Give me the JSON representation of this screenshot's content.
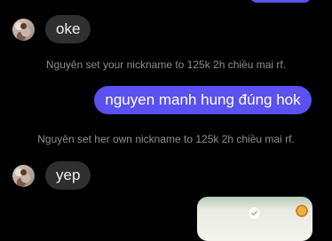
{
  "messages": {
    "incoming_1": {
      "text": "oke"
    },
    "system_1": {
      "text": "Nguyên set your nickname to 125k 2h chiều mai rf."
    },
    "outgoing_1": {
      "text": "nguyen manh hung đúng hok"
    },
    "system_2": {
      "text": "Nguyên set her own nickname to 125k 2h chiều mai rf."
    },
    "incoming_2": {
      "text": "yep"
    }
  },
  "colors": {
    "background": "#000000",
    "outgoing_bubble": "#5b50f0",
    "incoming_bubble": "#2f2f2f",
    "system_text": "#8e8e93"
  },
  "icons": {
    "photo_check": "check-circle-icon"
  }
}
